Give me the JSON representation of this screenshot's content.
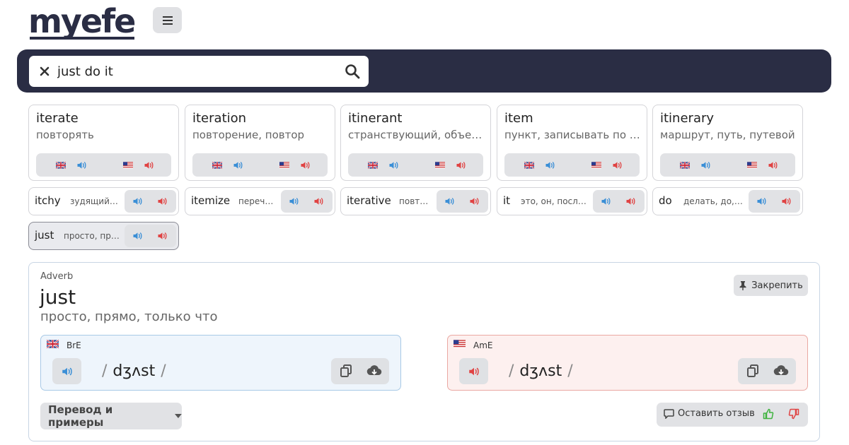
{
  "header": {
    "logo": "myefe",
    "menu_icon": "hamburger-icon"
  },
  "search": {
    "value": "just do it",
    "clear_icon": "close-icon",
    "search_icon": "search-icon"
  },
  "suggestions": [
    {
      "word": "iterate",
      "translation": "повторять"
    },
    {
      "word": "iteration",
      "translation": "повторение, повтор"
    },
    {
      "word": "itinerant",
      "translation": "странствующий, объезжающий"
    },
    {
      "word": "item",
      "translation": "пункт, записывать по пунктам"
    },
    {
      "word": "itinerary",
      "translation": "маршрут, путь, путевой"
    }
  ],
  "pills": [
    {
      "word": "itchy",
      "translation": "зудящий, чесоточный"
    },
    {
      "word": "itemize",
      "translation": "перечислять"
    },
    {
      "word": "iterative",
      "translation": "повторный"
    },
    {
      "word": "it",
      "translation": "это, он, последний"
    },
    {
      "word": "do",
      "translation": "делать, до, так"
    },
    {
      "word": "just",
      "translation": "просто, прямо"
    }
  ],
  "detail": {
    "pos": "Adverb",
    "word": "just",
    "translation": "просто, прямо, только что",
    "pin_label": "Закрепить",
    "bre": {
      "accent": "BrE",
      "ipa": "dʒʌst"
    },
    "ame": {
      "accent": "AmE",
      "ipa": "dʒʌst"
    },
    "slash": "/",
    "more_label": "Перевод и примеры",
    "feedback_label": "Оставить отзыв"
  },
  "colors": {
    "brand": "#2a2d44",
    "bre_blue": "#3b8fd6",
    "ame_red": "#e04444",
    "thumb_up": "#3fb33f",
    "thumb_down": "#e04444"
  }
}
